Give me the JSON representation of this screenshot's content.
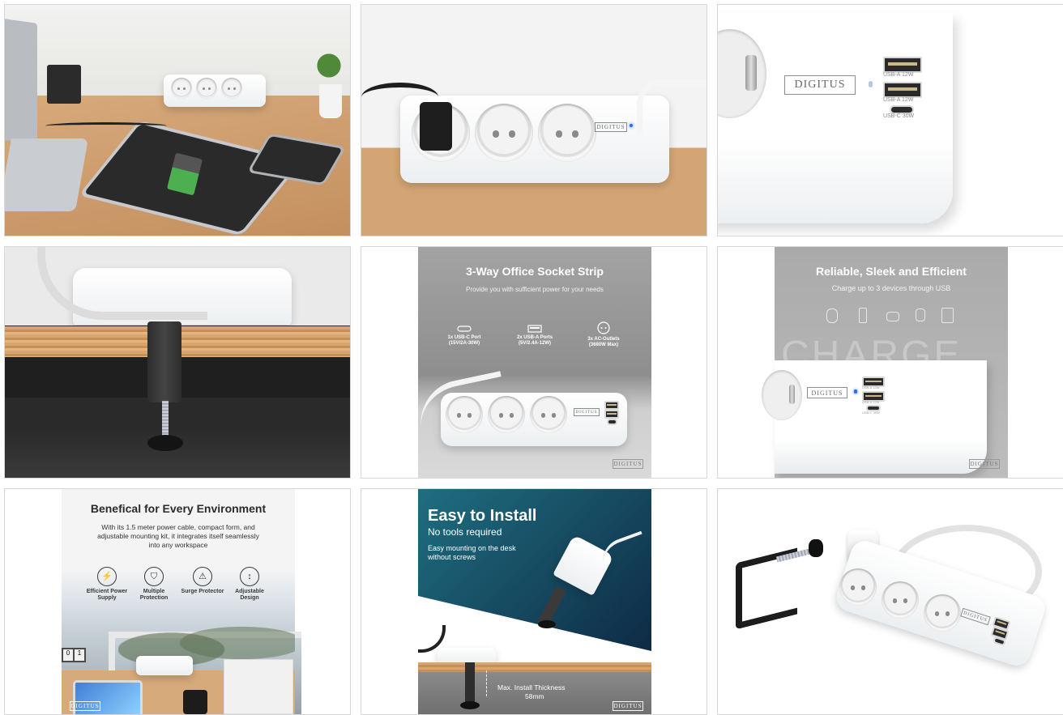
{
  "gallery": {
    "tiles": [
      {
        "id": 1
      },
      {
        "id": 2,
        "logo": "DIGITUS"
      },
      {
        "id": 3,
        "logo": "DIGITUS",
        "port_labels": [
          "USB-A 12W",
          "USB-A 12W",
          "USB-C 30W"
        ]
      },
      {
        "id": 4
      },
      {
        "id": 5,
        "title": "3-Way Office Socket Strip",
        "subtitle": "Provide you with sufficient power for your needs",
        "features": [
          {
            "label": "1x USB-C Port",
            "spec": "(15V/2A-30W)",
            "icon": "usb-c-icon"
          },
          {
            "label": "2x USB-A Ports",
            "spec": "(5V/2.4A-12W)",
            "icon": "usb-a-icon"
          },
          {
            "label": "3x AC-Outlets",
            "spec": "(3680W Max)",
            "icon": "ac-outlet-icon"
          }
        ],
        "logo": "DIGITUS"
      },
      {
        "id": 6,
        "title": "Reliable, Sleek and Efficient",
        "subtitle": "Charge up to 3 devices through USB",
        "watermark": "CHARGE UP",
        "device_icons": [
          "earbuds-icon",
          "phone-icon",
          "drone-icon",
          "watch-icon",
          "tablet-icon"
        ],
        "logo": "DIGITUS",
        "port_labels": [
          "USB-A 12W",
          "USB-A 12W",
          "USB-C 30W"
        ]
      },
      {
        "id": 7,
        "title": "Benefical for Every Environment",
        "body": "With its 1.5 meter power cable, compact form, and adjustable mounting kit, it integrates itself seamlessly into any workspace",
        "features": [
          {
            "label": "Efficient Power Supply",
            "icon": "lightning-icon"
          },
          {
            "label": "Multiple Protection",
            "icon": "shield-icon"
          },
          {
            "label": "Surge Protector",
            "icon": "warning-icon"
          },
          {
            "label": "Adjustable Design",
            "icon": "adjust-icon"
          }
        ],
        "calendar": [
          "0",
          "1"
        ],
        "logo": "DIGITUS"
      },
      {
        "id": 8,
        "title": "Easy to Install",
        "subtitle": "No tools required",
        "body": "Easy mounting on the desk without screws",
        "thickness_label": "Max. Install Thickness",
        "thickness_value": "58mm",
        "logo": "DIGITUS"
      },
      {
        "id": 9,
        "logo": "DIGITUS"
      }
    ],
    "colors": {
      "wood": "#c89a6a",
      "grey_panel": "#9e9e9e",
      "teal": "#1a5a6e",
      "navy": "#0f2d48",
      "led_blue": "#2b6cff"
    }
  }
}
